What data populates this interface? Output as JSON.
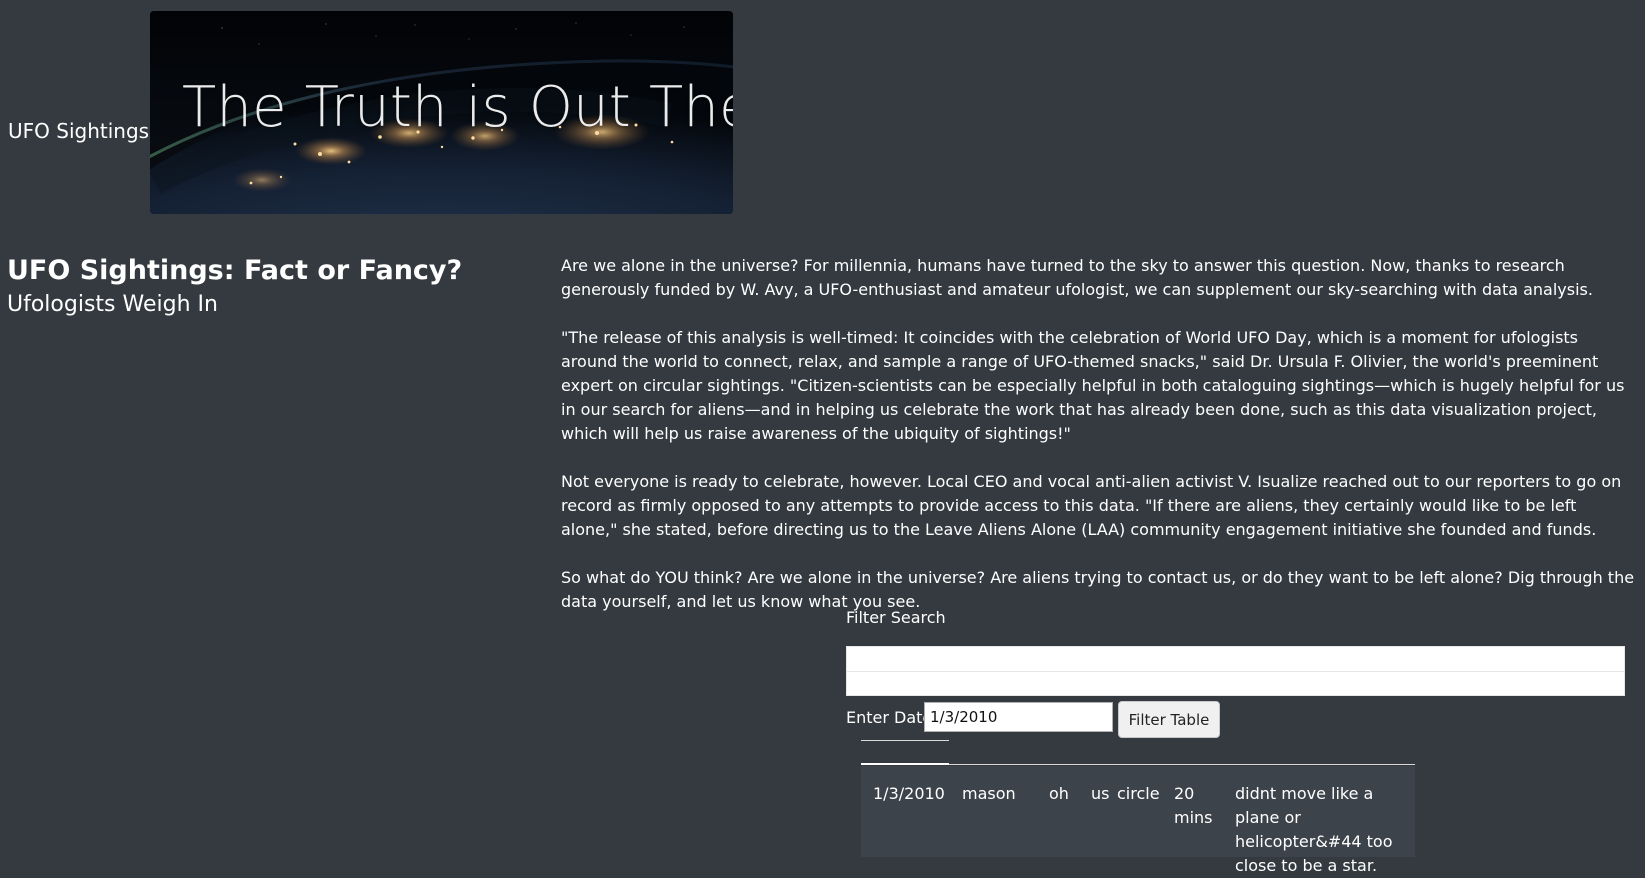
{
  "nav": {
    "brand": "UFO Sightings"
  },
  "banner": {
    "headline": "The Truth is Out There"
  },
  "page": {
    "title": "UFO Sightings: Fact or Fancy?",
    "subtitle": "Ufologists Weigh In"
  },
  "article": {
    "paragraphs": [
      "Are we alone in the universe? For millennia, humans have turned to the sky to answer this question. Now, thanks to research generously funded by W. Avy, a UFO-enthusiast and amateur ufologist, we can supplement our sky-searching with data analysis.",
      "\"The release of this analysis is well-timed: It coincides with the celebration of World UFO Day, which is a moment for ufologists around the world to connect, relax, and sample a range of UFO-themed snacks,\" said Dr. Ursula F. Olivier, the world's preeminent expert on circular sightings. \"Citizen-scientists can be especially helpful in both cataloguing sightings—which is hugely helpful for us in our search for aliens—and in helping us celebrate the work that has already been done, such as this data visualization project, which will help us raise awareness of the ubiquity of sightings!\"",
      "Not everyone is ready to celebrate, however. Local CEO and vocal anti-alien activist V. Isualize reached out to our reporters to go on record as firmly opposed to any attempts to provide access to this data. \"If there are aliens, they certainly would like to be left alone,\" she stated, before directing us to the Leave Aliens Alone (LAA) community engagement initiative she founded and funds.",
      "So what do YOU think? Are we alone in the universe? Are aliens trying to contact us, or do they want to be left alone? Dig through the data yourself, and let us know what you see."
    ]
  },
  "filter": {
    "title": "Filter Search",
    "date_label": "Enter Date",
    "date_value": "1/3/2010",
    "button_label": "Filter Table"
  },
  "results": {
    "rows": [
      {
        "date": "1/3/2010",
        "city": "mason",
        "state": "oh",
        "country": "us",
        "shape": "circle",
        "duration": "20 mins",
        "comment": "didnt move like a plane or helicopter&#44 too close to be a star."
      }
    ]
  },
  "colors": {
    "background": "#343a40",
    "text": "#ffffff",
    "row": "#3d434a"
  },
  "icons": {
    "banner": "earth-night-image"
  }
}
